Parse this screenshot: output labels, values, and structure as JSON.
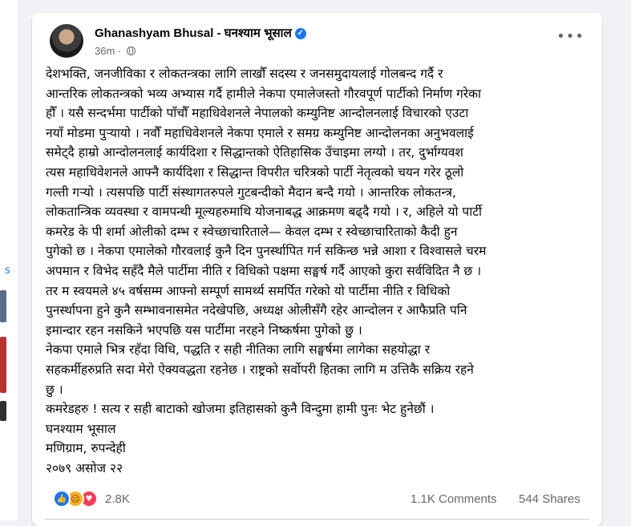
{
  "post": {
    "author": "Ghanashyam Bhusal - घनश्याम भूसाल",
    "time": "36m",
    "body_lines": [
      "देशभक्ति, जनजीविका र लोकतन्त्रका लागि लाखौँ सदस्य र जनसमुदायलाई गोलबन्द गर्दै र",
      "आन्तरिक लोकतन्त्रको भव्य अभ्यास गर्दै हामीले नेकपा एमालेजस्तो गौरवपूर्ण पार्टीको निर्माण गरेका",
      "हौँ । यसै सन्दर्भमा पार्टीको पाँचौँ महाधिवेशनले नेपालको कम्युनिष्ट आन्दोलनलाई विचारको एउटा",
      "नयाँ मोडमा पुर्‍यायो । नवौँ महाधिवेशनले नेकपा एमाले र समग्र कम्युनिष्ट आन्दोलनका अनुभवलाई",
      "समेट्दै हाम्रो आन्दोलनलाई कार्यदिशा र सिद्धान्तको ऐतिहासिक उँचाइमा लग्यो । तर, दुर्भाग्यवश",
      "त्यस महाधिवेशनले आफ्नै कार्यदिशा र सिद्धान्त विपरीत चरित्रको पार्टी नेतृत्वको चयन गरेर ठूलो",
      "गल्ती गर्‍यो । त्यसपछि पार्टी संस्थागतरुपले गुटबन्दीको मैदान बन्दै गयो । आन्तरिक लोकतन्त्र,",
      "लोकतान्त्रिक व्यवस्था र वामपन्थी मूल्यहरुमाथि योजनाबद्ध आक्रमण बढ्दै गयो । र, अहिले यो पार्टी",
      "कमरेड के पी शर्मा ओलीको दम्भ र स्वेच्छाचारिताले— केवल दम्भ र स्वेच्छाचारिताको कैदी हुन",
      "पुगेको छ । नेकपा एमालेको गौरवलाई कुनै दिन पुनर्स्थापित गर्न सकिन्छ भन्ने आशा र विश्वासले चरम",
      "अपमान र विभेद सहँदै मैले पार्टीमा नीति र विधिको पक्षमा सङ्घर्ष गर्दै आएको कुरा सर्वविदित नै छ ।",
      "तर म स्वयमले ४५ वर्षसम्म आफ्नो सम्पूर्ण सामर्थ्य समर्पित गरेको यो पार्टीमा नीति र विधिको",
      "पुनर्स्थापना हुने कुनै सम्भावनासमेत नदेखेपछि, अध्यक्ष ओलीसँगै रहेर आन्दोलन र आफैप्रति पनि",
      "इमान्दार रहन नसकिने भएपछि यस पार्टीमा नरहने निष्कर्षमा पुगेको छु ।",
      "नेकपा एमाले भित्र रहँदा विधि, पद्धति र सही नीतिका लागि सङ्घर्षमा लागेका सहयोद्धा र",
      "सहकर्मीहरुप्रति सदा मेरो ऐक्यवद्धता रहनेछ । राष्ट्रको सर्वोपरी हितका लागि म उत्तिकै सक्रिय रहने",
      "छु ।",
      "कमरेडहरु ! सत्य र सही बाटाको खोजमा इतिहासको कुनै विन्दुमा हामी पुनः भेट हुनेछौं ।",
      "घनश्याम भूसाल",
      "मणिग्राम, रुपन्देही",
      "२०७९ असोज २२"
    ],
    "reaction_count": "2.8K",
    "comments": "1.1K Comments",
    "shares": "544 Shares"
  },
  "colors": {
    "accent": "#1877f2",
    "love": "#f33e58",
    "sad": "#f7b125",
    "secondary_text": "#65676b"
  }
}
